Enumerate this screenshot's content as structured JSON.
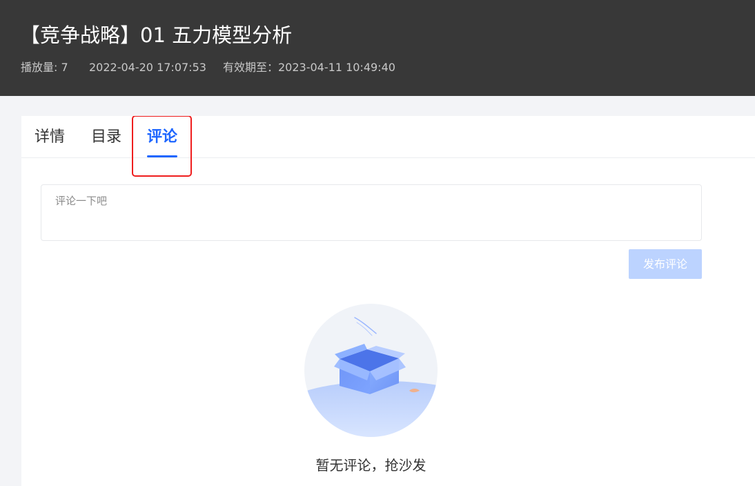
{
  "header": {
    "title": "【竞争战略】01 五力模型分析",
    "meta": {
      "plays": "播放量: 7",
      "date": "2022-04-20 17:07:53",
      "expiry": "有效期至：2023-04-11 10:49:40"
    }
  },
  "tabs": [
    {
      "label": "详情",
      "active": false
    },
    {
      "label": "目录",
      "active": false
    },
    {
      "label": "评论",
      "active": true
    }
  ],
  "comment": {
    "placeholder": "评论一下吧",
    "publish_label": "发布评论"
  },
  "empty_state": {
    "icon": "empty-box-icon",
    "text": "暂无评论，抢沙发"
  },
  "colors": {
    "header_background": "#383838",
    "accent": "#1e66ff",
    "highlight": "#ef1d1d",
    "disabled_button": "#bcd3ff"
  }
}
